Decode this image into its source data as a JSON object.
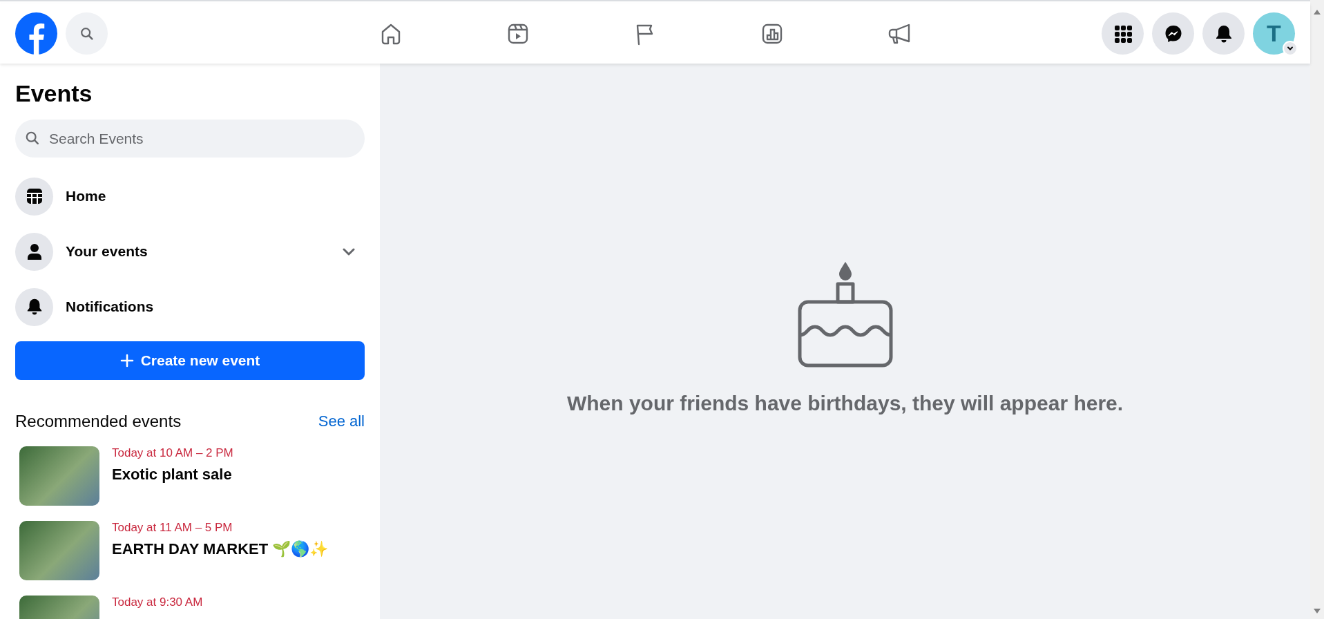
{
  "header": {
    "nav_tabs": [
      {
        "kind": "home"
      },
      {
        "kind": "video"
      },
      {
        "kind": "pages"
      },
      {
        "kind": "stats"
      },
      {
        "kind": "ads"
      }
    ],
    "actions": [
      {
        "kind": "apps"
      },
      {
        "kind": "messenger"
      },
      {
        "kind": "notifications"
      }
    ],
    "profile": {
      "initial": "T"
    }
  },
  "sidebar": {
    "title": "Events",
    "search": {
      "placeholder": "Search Events"
    },
    "menu": [
      {
        "label": "Home",
        "kind": "calendar",
        "expandable": false
      },
      {
        "label": "Your events",
        "kind": "person",
        "expandable": true
      },
      {
        "label": "Notifications",
        "kind": "bell",
        "expandable": false
      }
    ],
    "create_button": "Create new event",
    "recommended": {
      "heading": "Recommended events",
      "see_all": "See all",
      "events": [
        {
          "time": "Today at 10 AM – 2 PM",
          "title": "Exotic plant sale"
        },
        {
          "time": "Today at 11 AM – 5 PM",
          "title": "EARTH DAY MARKET 🌱🌎✨"
        },
        {
          "time": "Today at 9:30 AM"
        }
      ]
    }
  },
  "main": {
    "message": "When your friends have birthdays, they will appear here."
  }
}
